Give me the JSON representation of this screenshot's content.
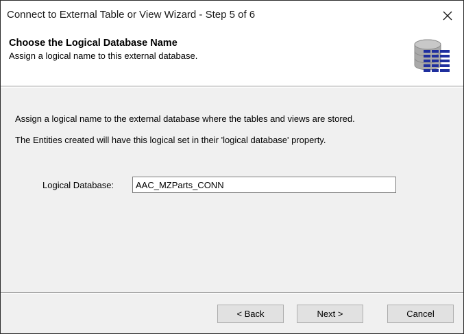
{
  "window": {
    "title": "Connect to External Table or View Wizard - Step 5 of 6",
    "close_icon": "close-icon"
  },
  "header": {
    "title": "Choose the Logical Database Name",
    "subtitle": "Assign a logical name to this external database.",
    "icon": "database-icon"
  },
  "body": {
    "description_line1": "Assign a logical name to the external database where the tables and views are stored.",
    "description_line2": "The Entities created will have this logical set in their 'logical database' property.",
    "logical_database_label": "Logical Database:",
    "logical_database_value": "AAC_MZParts_CONN"
  },
  "buttons": {
    "back": "< Back",
    "next": "Next >",
    "cancel": "Cancel"
  },
  "colors": {
    "icon_blue": "#1f2f9e",
    "icon_gray": "#8c8c8c"
  }
}
